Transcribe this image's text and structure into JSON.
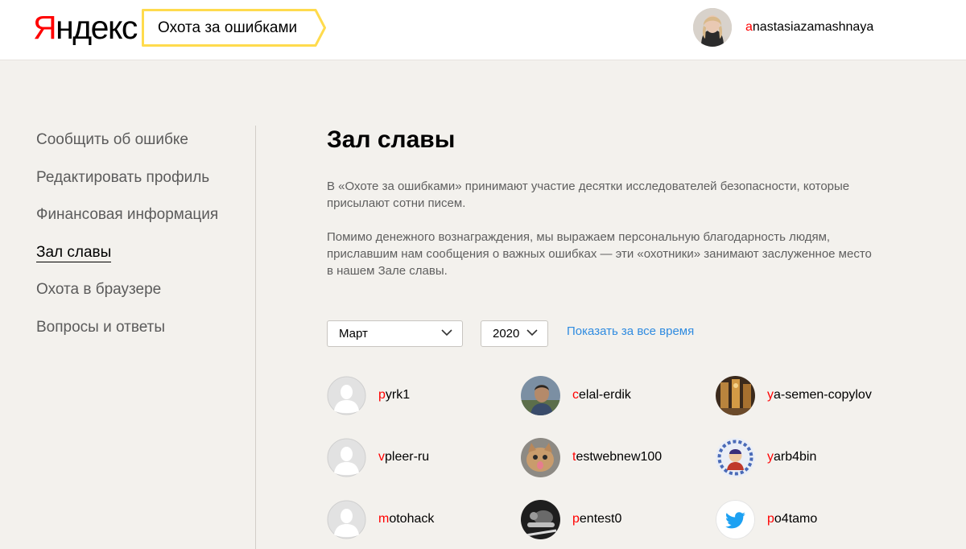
{
  "header": {
    "logo_first": "Я",
    "logo_rest": "ндекс",
    "service_title": "Охота за ошибками",
    "user_first": "a",
    "user_rest": "nastasiazamashnaya"
  },
  "sidebar": {
    "items": [
      {
        "label": "Сообщить об ошибке",
        "active": false
      },
      {
        "label": "Редактировать профиль",
        "active": false
      },
      {
        "label": "Финансовая информация",
        "active": false
      },
      {
        "label": "Зал славы",
        "active": true
      },
      {
        "label": "Охота в браузере",
        "active": false
      },
      {
        "label": "Вопросы и ответы",
        "active": false
      }
    ]
  },
  "main": {
    "title": "Зал славы",
    "paragraph1": "В «Охоте за ошибками» принимают участие десятки исследователей безопасности, которые присылают сотни писем.",
    "paragraph2": "Помимо денежного вознаграждения, мы выражаем персональную благодарность людям, приславшим нам сообщения о важных ошибках — эти «охотники» занимают заслуженное место в нашем Зале славы.",
    "filters": {
      "month_selected": "Март",
      "year_selected": "2020",
      "all_time_link": "Показать за все время"
    },
    "hunters": [
      {
        "first": "p",
        "rest": "yrk1",
        "avatar": "default-avatar-icon"
      },
      {
        "first": "c",
        "rest": "elal-erdik",
        "avatar": "photo-avatar-man"
      },
      {
        "first": "y",
        "rest": "a-semen-copylov",
        "avatar": "photo-avatar-building"
      },
      {
        "first": "v",
        "rest": "pleer-ru",
        "avatar": "default-avatar-icon"
      },
      {
        "first": "t",
        "rest": "estwebnew100",
        "avatar": "photo-avatar-cat"
      },
      {
        "first": "y",
        "rest": "arb4bin",
        "avatar": "photo-avatar-illustration"
      },
      {
        "first": "m",
        "rest": "otohack",
        "avatar": "default-avatar-icon"
      },
      {
        "first": "p",
        "rest": "entest0",
        "avatar": "photo-avatar-dark"
      },
      {
        "first": "p",
        "rest": "o4tamo",
        "avatar": "twitter-bird-icon"
      }
    ]
  },
  "colors": {
    "accent_red": "#ff0000",
    "link_blue": "#2f8be0",
    "tag_yellow": "#ffdb4d",
    "background": "#f3f1ed"
  }
}
